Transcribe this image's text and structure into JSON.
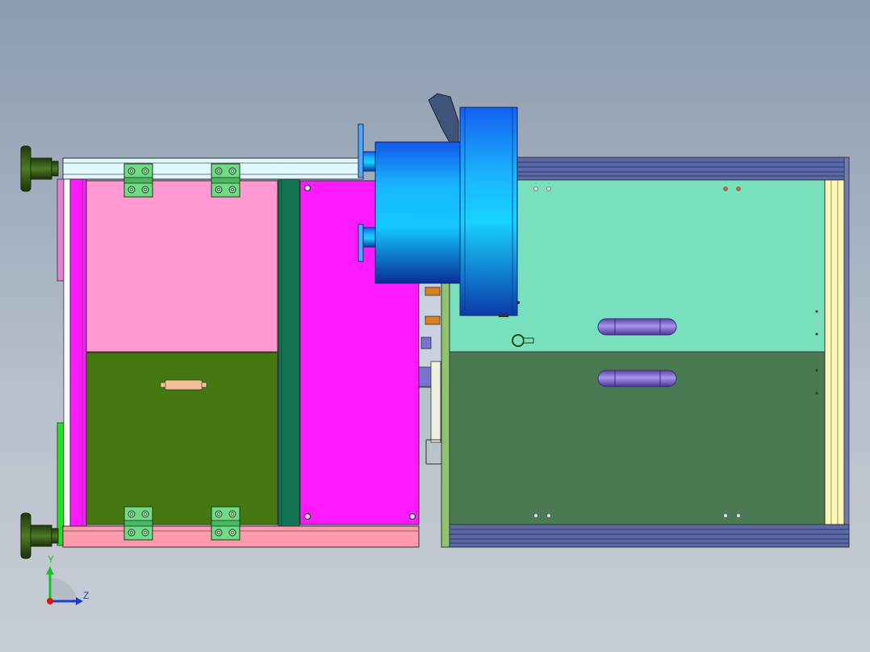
{
  "viewport": {
    "background_top": "#8c9bb0",
    "background_bottom": "#c7cdd4"
  },
  "axis_triad": {
    "y_label": "Y",
    "z_label": "Z",
    "y_color": "#11c422",
    "z_color": "#1a3fd0",
    "x_color": "#e01010"
  },
  "colors": {
    "magenta": "#ff19ff",
    "pink_panel": "#ff99cf",
    "olive_panel": "#467812",
    "dark_green_strip": "#167456",
    "mint_panel": "#79e0bd",
    "dark_panel": "#4a7a52",
    "navy_rails": "#5b6aa6",
    "cyan_cylinder": "#18b8ff",
    "light_yellow_strip": "#fff8b0",
    "hinge_green": "#6fdc84",
    "knob": "#2f5418",
    "purple_handle": "#8a73d8"
  }
}
